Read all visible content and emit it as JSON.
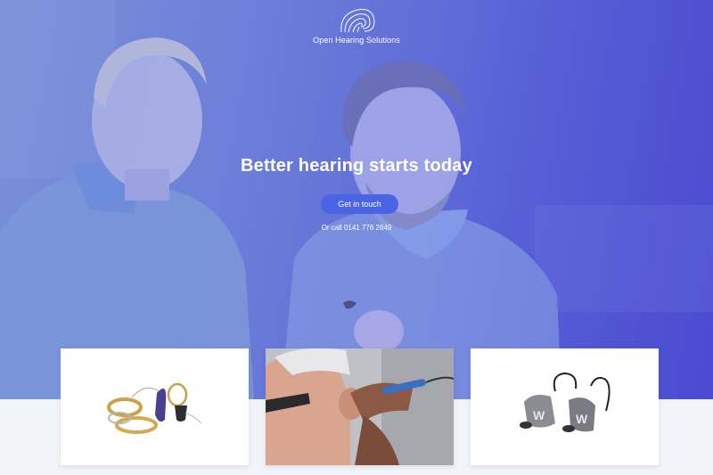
{
  "brand": {
    "name": "Open Hearing Solutions",
    "logo_icon": "shell-logo-icon"
  },
  "hero": {
    "headline": "Better hearing starts today",
    "cta_label": "Get in touch",
    "call_text": "Or call 0141 776 2649",
    "image": "two-men-smiling-photo"
  },
  "cards": [
    {
      "image": "hearing-aids-and-rings-photo"
    },
    {
      "image": "ear-examination-photo"
    },
    {
      "image": "in-ear-monitors-photo"
    }
  ],
  "colors": {
    "accent": "#4b64e6",
    "hero_tint": "#5a62d6",
    "page_bg": "#f1f4f8"
  }
}
